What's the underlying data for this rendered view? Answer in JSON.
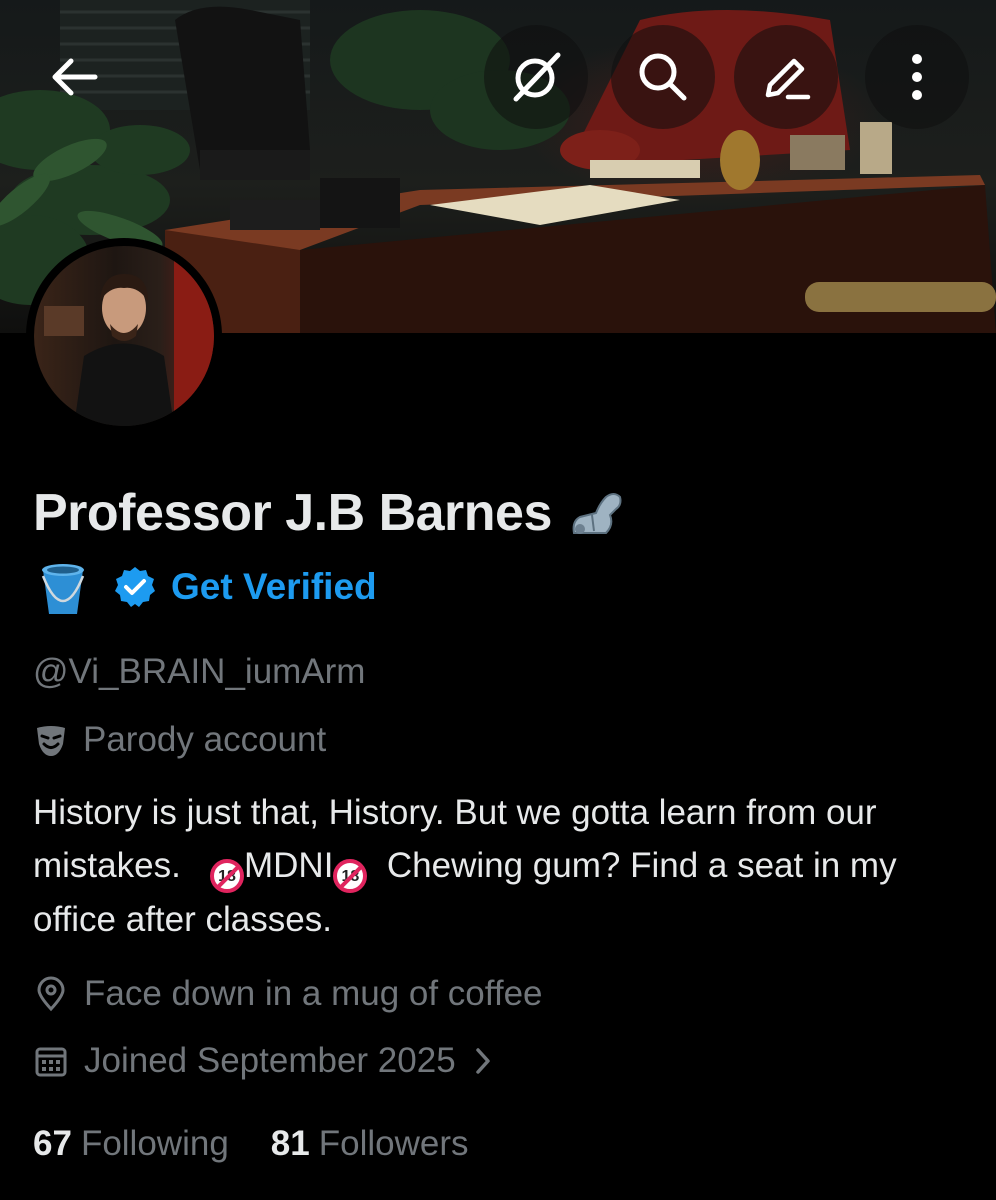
{
  "header": {
    "back_icon": "arrow-left-icon",
    "grok_icon": "grok-icon",
    "search_icon": "search-icon",
    "edit_icon": "pencil-icon",
    "more_icon": "more-vertical-icon"
  },
  "profile": {
    "display_name": "Professor J.B Barnes",
    "name_emoji": "mechanical-arm-icon",
    "badge_emoji": "bucket-icon",
    "get_verified_label": "Get Verified",
    "handle": "@Vi_BRAIN_iumArm",
    "parody_label": "Parody account",
    "bio_part1": "History is just that, History. But we gotta learn from our mistakes.",
    "bio_badge1": "18",
    "bio_mid": "MDNI",
    "bio_badge2": "18",
    "bio_part2": "Chewing gum? Find a seat in my office after classes.",
    "location": "Face down in a mug of coffee",
    "joined": "Joined September 2025",
    "following_count": "67",
    "following_label": "Following",
    "followers_count": "81",
    "followers_label": "Followers"
  },
  "colors": {
    "background": "#000000",
    "primary_text": "#e7e9ea",
    "secondary_text": "#71767b",
    "accent_blue": "#1d9bf0"
  }
}
